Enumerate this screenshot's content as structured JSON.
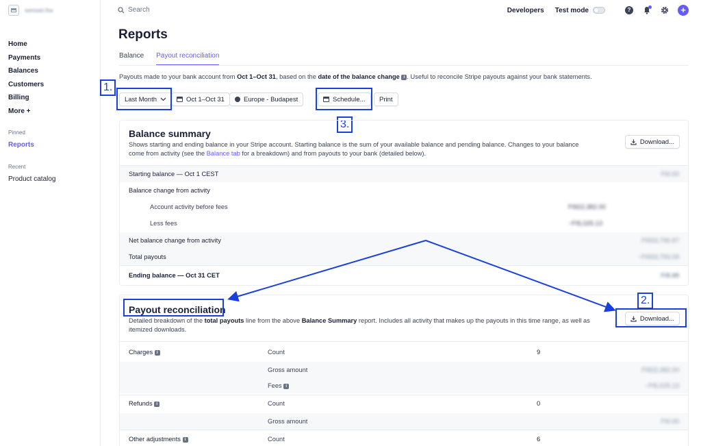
{
  "sidebar": {
    "account_name": "sensei.hu",
    "items": [
      {
        "label": "Home"
      },
      {
        "label": "Payments"
      },
      {
        "label": "Balances"
      },
      {
        "label": "Customers"
      },
      {
        "label": "Billing"
      },
      {
        "label": "More +"
      }
    ],
    "pinned_label": "Pinned",
    "pinned_items": [
      {
        "label": "Reports"
      }
    ],
    "recent_label": "Recent",
    "recent_items": [
      {
        "label": "Product catalog"
      }
    ]
  },
  "topbar": {
    "search_placeholder": "Search",
    "developers": "Developers",
    "test_mode": "Test mode",
    "help_glyph": "?",
    "plus_glyph": "+"
  },
  "page": {
    "title": "Reports",
    "tabs": [
      {
        "label": "Balance"
      },
      {
        "label": "Payout reconciliation"
      }
    ],
    "desc_pre": "Payouts made to your bank account from ",
    "desc_range": "Oct 1–Oct 31",
    "desc_mid": ", based on the ",
    "desc_bold": "date of the balance change",
    "desc_post": ". Useful to reconcile Stripe payouts against your bank statements."
  },
  "toolbar": {
    "period": "Last Month",
    "range": "Oct 1–Oct 31",
    "timezone": "Europe - Budapest",
    "schedule": "Schedule...",
    "print": "Print"
  },
  "annotations": {
    "one": "1.",
    "two": "2.",
    "three": "3."
  },
  "balance_summary": {
    "title": "Balance summary",
    "desc_1": "Shows starting and ending balance in your Stripe account. Starting balance is the sum of your available balance and pending balance. Changes to your balance",
    "desc_2a": "come from activity (see the ",
    "desc_link": "Balance tab",
    "desc_2b": " for a breakdown) and from payouts to your bank (detailed below).",
    "download": "Download...",
    "rows": {
      "starting": {
        "label": "Starting balance — Oct 1 CEST",
        "value": "Ft0.00"
      },
      "change": {
        "label": "Balance change from activity"
      },
      "before_fees": {
        "label": "Account activity before fees",
        "value": "Ft922,382.00"
      },
      "less_fees": {
        "label": "Less fees",
        "value": "−Ft5,025.13"
      },
      "net": {
        "label": "Net balance change from activity",
        "value": "Ft553,795.87"
      },
      "payouts": {
        "label": "Total payouts",
        "value": "−Ft553,793.09"
      },
      "ending": {
        "label": "Ending balance — Oct 31 CET",
        "value": "Ft8.88"
      }
    }
  },
  "payout_reconciliation": {
    "title": "Payout reconciliation",
    "desc_1a": "Detailed breakdown of the ",
    "desc_1b": "total payouts",
    "desc_1c": " line from the above ",
    "desc_1d": "Balance Summary",
    "desc_1e": " report. Includes all activity that makes up the payouts in this time range, as well as",
    "desc_2": "itemized downloads.",
    "download": "Download...",
    "rows": {
      "charges": {
        "label": "Charges",
        "count_label": "Count",
        "count": "9"
      },
      "charges_gross": {
        "label": "Gross amount",
        "value": "Ft922,382.00"
      },
      "charges_fees": {
        "label": "Fees",
        "value": "−Ft5,025.13"
      },
      "refunds": {
        "label": "Refunds",
        "count_label": "Count",
        "count": "0"
      },
      "refunds_gross": {
        "label": "Gross amount",
        "value": "Ft0.00"
      },
      "other": {
        "label": "Other adjustments",
        "count_label": "Count",
        "count": "6"
      }
    }
  }
}
